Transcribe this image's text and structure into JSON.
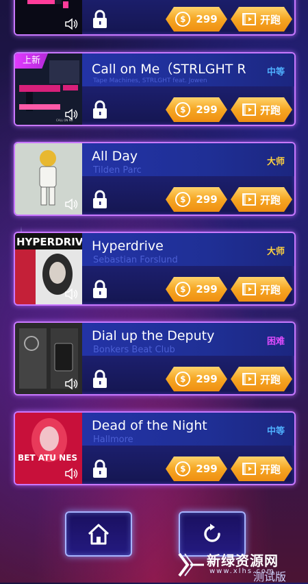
{
  "songs": [
    {
      "title": "",
      "artist": "",
      "difficulty": "",
      "difficulty_color": "#4fb0ff",
      "price": "299",
      "run_label": "开跑",
      "is_new": false,
      "new_label": ""
    },
    {
      "title": "Call on Me（STRLGHT R",
      "artist": "Tape Machines, STRLGHT feat. Jowen",
      "difficulty": "中等",
      "difficulty_color": "#4fb0ff",
      "price": "299",
      "run_label": "开跑",
      "is_new": true,
      "new_label": "上新"
    },
    {
      "title": "All Day",
      "artist": "Tilden Parc",
      "difficulty": "大师",
      "difficulty_color": "#ffd23f",
      "price": "299",
      "run_label": "开跑",
      "is_new": false,
      "new_label": ""
    },
    {
      "title": "Hyperdrive",
      "artist": "Sebastian Forslund",
      "difficulty": "大师",
      "difficulty_color": "#ffd23f",
      "price": "299",
      "run_label": "开跑",
      "is_new": false,
      "new_label": "",
      "cover_text": "HYPERDRIVE"
    },
    {
      "title": "Dial up the Deputy",
      "artist": "Bonkers Beat Club",
      "difficulty": "困难",
      "difficulty_color": "#e04cff",
      "price": "299",
      "run_label": "开跑",
      "is_new": false,
      "new_label": ""
    },
    {
      "title": "Dead of the Night",
      "artist": "Hallmore",
      "difficulty": "中等",
      "difficulty_color": "#4fb0ff",
      "price": "299",
      "run_label": "开跑",
      "is_new": false,
      "new_label": "",
      "cover_text": "BET ATU NES"
    }
  ],
  "nav": {
    "home_icon": "home-icon",
    "refresh_icon": "refresh-icon"
  },
  "watermark": {
    "title": "新绿资源网",
    "url": "www.xlhs.com",
    "test_label": "测试版"
  },
  "colors": {
    "card_border": "#c978ff",
    "button_orange": "#f5a623",
    "artist_text": "#4c5fd4"
  }
}
